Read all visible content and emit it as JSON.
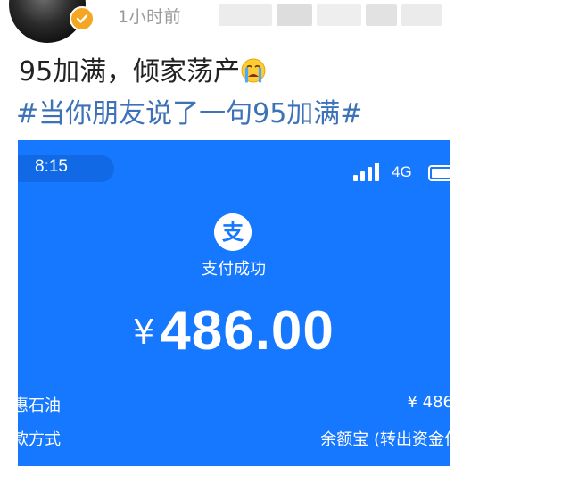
{
  "post": {
    "time": "1小时前",
    "text": "95加满，倾家荡产",
    "emoji": "crying-face-emoji",
    "hashtag": "#当你朋友说了一句95加满#"
  },
  "screenshot": {
    "status_time": "8:15",
    "network": "4G",
    "pay_logo_char": "支",
    "payment_status": "支付成功",
    "currency": "¥",
    "amount": "486.00",
    "merchant": "惠石油",
    "merchant_amount": "¥ 486",
    "method_label": "付款方式",
    "method_value": "余额宝 (转出资金付"
  },
  "colors": {
    "screenshot_bg": "#1677ff",
    "hashtag": "#3d72b8",
    "verified_badge": "#f5a623"
  }
}
